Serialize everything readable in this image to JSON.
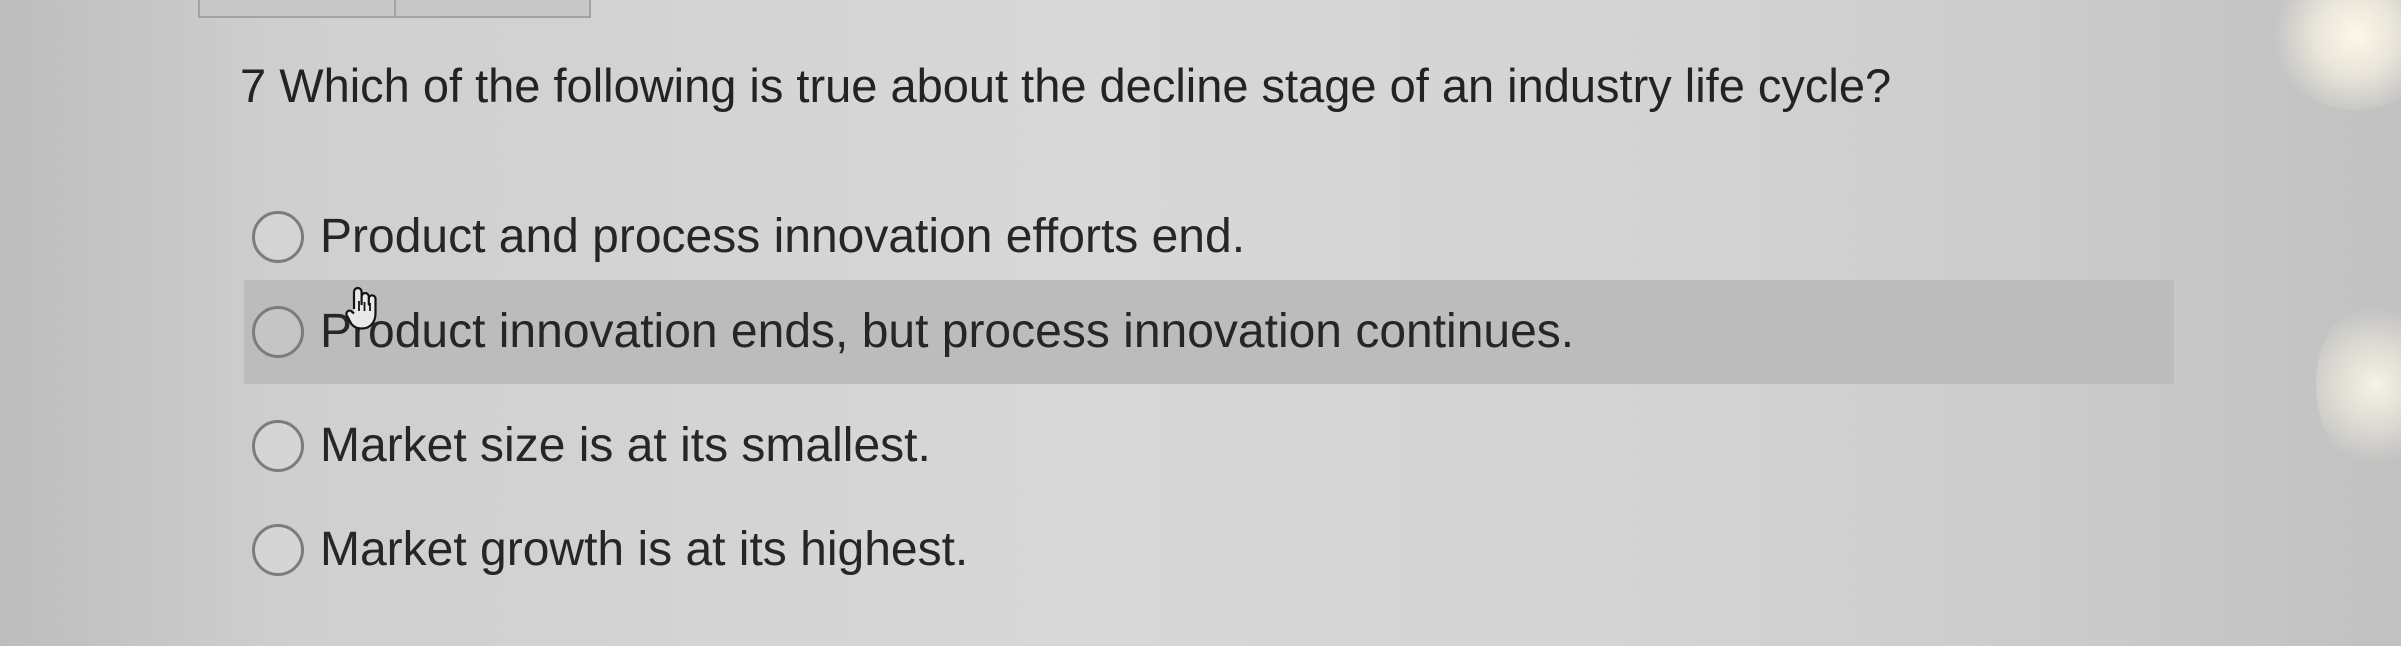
{
  "question": {
    "number": "7",
    "text": "Which of the following is true about the decline stage of an industry life cycle?"
  },
  "answers": [
    {
      "label": "Product and process innovation efforts end.",
      "highlighted": false
    },
    {
      "label": "Product innovation ends, but process innovation continues.",
      "highlighted": true
    },
    {
      "label": "Market size is at its smallest.",
      "highlighted": false
    },
    {
      "label": "Market growth is at its highest.",
      "highlighted": false
    }
  ],
  "icons": {
    "radio": "radio-button-icon",
    "cursor": "hand-pointer-icon"
  },
  "colors": {
    "text": "#262626",
    "highlight": "#bcbcbc",
    "radio_border": "#7c7c7c"
  }
}
